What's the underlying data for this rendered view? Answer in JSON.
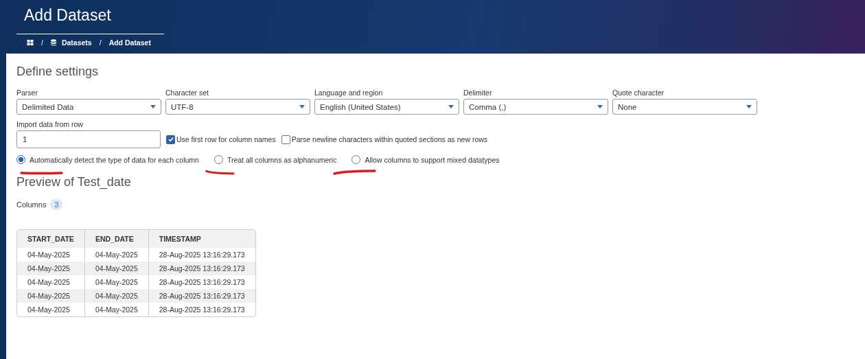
{
  "header": {
    "title": "Add Dataset",
    "separator": "/",
    "breadcrumb": [
      {
        "kind": "home"
      },
      {
        "kind": "datasets",
        "label": "Datasets"
      },
      {
        "kind": "current",
        "label": "Add Dataset"
      }
    ]
  },
  "settings": {
    "title": "Define settings",
    "selects": [
      {
        "label": "Parser",
        "value": "Delimited Data"
      },
      {
        "label": "Character set",
        "value": "UTF-8"
      },
      {
        "label": "Language and region",
        "value": "English (United States)"
      },
      {
        "label": "Delimiter",
        "value": "Comma (,)"
      },
      {
        "label": "Quote character",
        "value": "None"
      }
    ],
    "import_row": {
      "label": "Import data from row",
      "value": "1"
    },
    "checkboxes": [
      {
        "label": "Use first row for column names",
        "checked": true
      },
      {
        "label": "Parse newline characters within quoted sections as new rows",
        "checked": false
      }
    ],
    "radios": [
      {
        "label": "Automatically detect the type of data for each column",
        "selected": true,
        "marked": true
      },
      {
        "label": "Treat all columns as alphanumeric",
        "selected": false,
        "marked": true
      },
      {
        "label": "Allow columns to support mixed datatypes",
        "selected": false,
        "marked": true
      }
    ]
  },
  "preview": {
    "title": "Preview of Test_date",
    "columns_label": "Columns",
    "columns_count": "3",
    "table": {
      "columns": [
        "START_DATE",
        "END_DATE",
        "TIMESTAMP"
      ],
      "rows": [
        [
          "04-May-2025",
          "04-May-2025",
          "28-Aug-2025 13:16:29.173"
        ],
        [
          "04-May-2025",
          "04-May-2025",
          "28-Aug-2025 13:16:29.173"
        ],
        [
          "04-May-2025",
          "04-May-2025",
          "28-Aug-2025 13:16:29.173"
        ],
        [
          "04-May-2025",
          "04-May-2025",
          "28-Aug-2025 13:16:29.173"
        ],
        [
          "04-May-2025",
          "04-May-2025",
          "28-Aug-2025 13:16:29.173"
        ]
      ]
    }
  }
}
